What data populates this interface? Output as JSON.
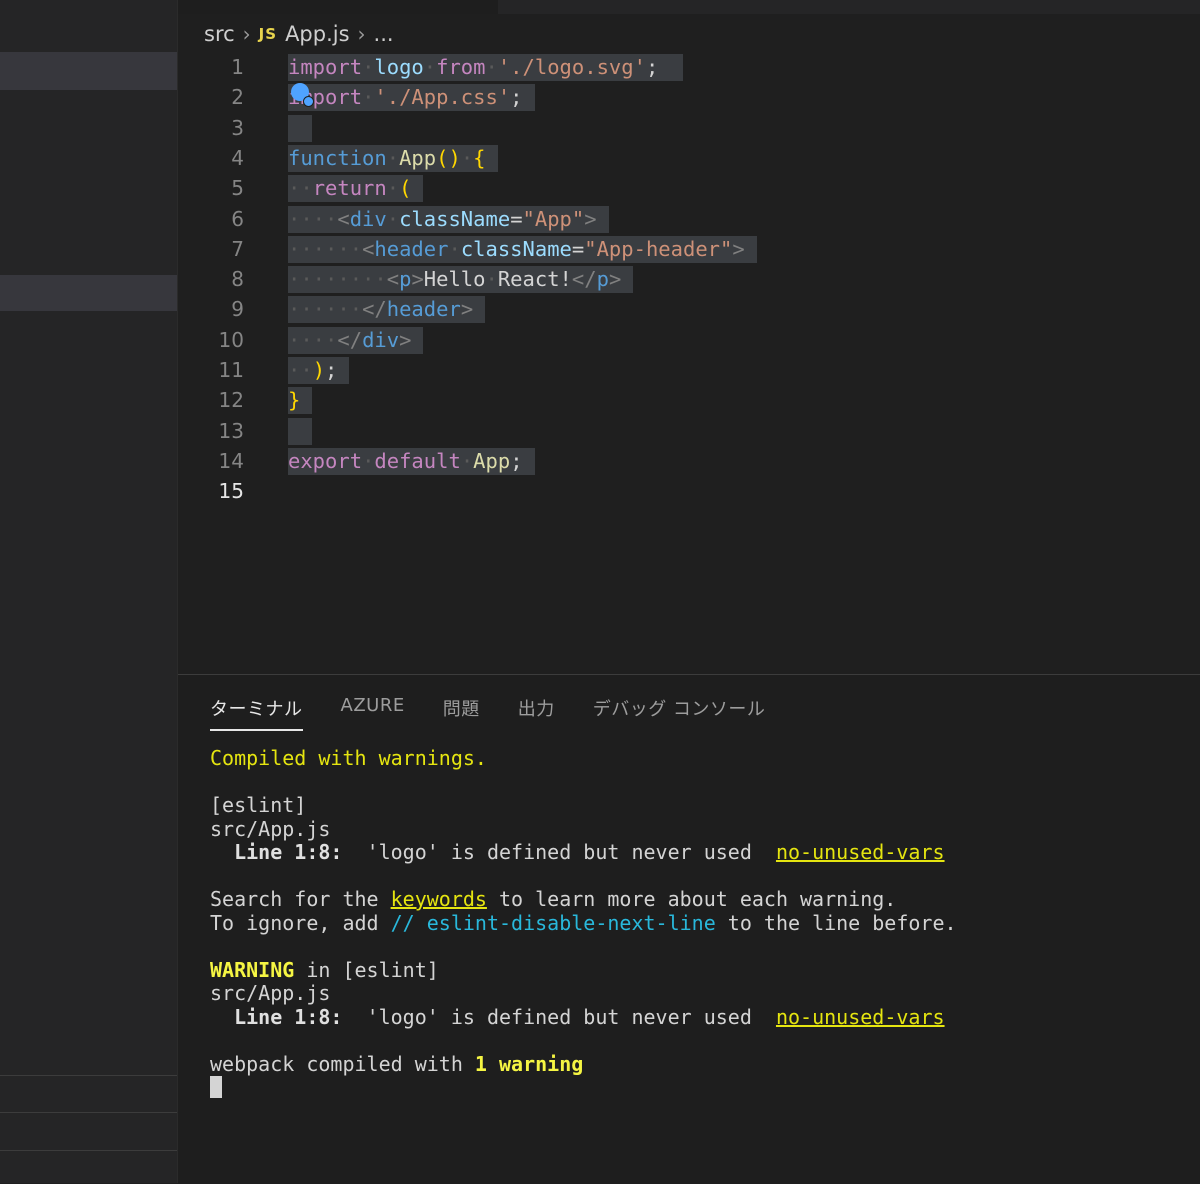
{
  "breadcrumb": {
    "folder": "src",
    "file_badge": "JS",
    "file": "App.js",
    "more": "..."
  },
  "editor": {
    "active_line": 15,
    "lines": [
      {
        "n": "1",
        "tokens": [
          [
            "k1",
            "import"
          ],
          [
            "ws",
            "·"
          ],
          [
            "id",
            "logo"
          ],
          [
            "ws",
            "·"
          ],
          [
            "k1",
            "from"
          ],
          [
            "ws",
            "·"
          ],
          [
            "str",
            "'./logo.svg'"
          ],
          [
            "",
            "; "
          ]
        ]
      },
      {
        "n": "2",
        "tokens": [
          [
            "k1",
            "import"
          ],
          [
            "ws",
            "·"
          ],
          [
            "str",
            "'./App.css'"
          ],
          [
            "",
            ";"
          ]
        ]
      },
      {
        "n": "3",
        "tokens": []
      },
      {
        "n": "4",
        "tokens": [
          [
            "kb",
            "function"
          ],
          [
            "ws",
            "·"
          ],
          [
            "fn",
            "App"
          ],
          [
            "br",
            "()"
          ],
          [
            "ws",
            "·"
          ],
          [
            "br",
            "{"
          ]
        ]
      },
      {
        "n": "5",
        "tokens": [
          [
            "ws",
            "··"
          ],
          [
            "k1",
            "return"
          ],
          [
            "ws",
            "·"
          ],
          [
            "br",
            "("
          ]
        ]
      },
      {
        "n": "6",
        "tokens": [
          [
            "ws",
            "····"
          ],
          [
            "tagp",
            "<"
          ],
          [
            "tag",
            "div"
          ],
          [
            "ws",
            "·"
          ],
          [
            "at",
            "className"
          ],
          [
            "",
            "="
          ],
          [
            "str",
            "\"App\""
          ],
          [
            "tagp",
            ">"
          ]
        ]
      },
      {
        "n": "7",
        "tokens": [
          [
            "ws",
            "······"
          ],
          [
            "tagp",
            "<"
          ],
          [
            "tag",
            "header"
          ],
          [
            "ws",
            "·"
          ],
          [
            "at",
            "className"
          ],
          [
            "",
            "="
          ],
          [
            "str",
            "\"App-header\""
          ],
          [
            "tagp",
            ">"
          ]
        ]
      },
      {
        "n": "8",
        "tokens": [
          [
            "ws",
            "········"
          ],
          [
            "tagp",
            "<"
          ],
          [
            "tag",
            "p"
          ],
          [
            "tagp",
            ">"
          ],
          [
            "",
            "Hello"
          ],
          [
            "ws",
            "·"
          ],
          [
            "",
            "React!"
          ],
          [
            "tagp",
            "</"
          ],
          [
            "tag",
            "p"
          ],
          [
            "tagp",
            ">"
          ]
        ]
      },
      {
        "n": "9",
        "tokens": [
          [
            "ws",
            "······"
          ],
          [
            "tagp",
            "</"
          ],
          [
            "tag",
            "header"
          ],
          [
            "tagp",
            ">"
          ]
        ]
      },
      {
        "n": "10",
        "tokens": [
          [
            "ws",
            "····"
          ],
          [
            "tagp",
            "</"
          ],
          [
            "tag",
            "div"
          ],
          [
            "tagp",
            ">"
          ]
        ]
      },
      {
        "n": "11",
        "tokens": [
          [
            "ws",
            "··"
          ],
          [
            "br",
            ")"
          ],
          [
            "",
            ";"
          ]
        ]
      },
      {
        "n": "12",
        "tokens": [
          [
            "br",
            "}"
          ]
        ]
      },
      {
        "n": "13",
        "tokens": []
      },
      {
        "n": "14",
        "tokens": [
          [
            "k1",
            "export"
          ],
          [
            "ws",
            "·"
          ],
          [
            "k1",
            "default"
          ],
          [
            "ws",
            "·"
          ],
          [
            "fn",
            "App"
          ],
          [
            "",
            ";"
          ]
        ]
      },
      {
        "n": "15",
        "tokens": null
      }
    ]
  },
  "panel": {
    "tabs": [
      "ターミナル",
      "AZURE",
      "問題",
      "出力",
      "デバッグ コンソール"
    ],
    "active_tab": 0
  },
  "terminal": {
    "compiled": "Compiled with warnings.",
    "eslint_tag": "[eslint]",
    "file": "src/App.js",
    "line_label": "Line 1:8:",
    "message": "'logo' is defined but never used",
    "rule": "no-unused-vars",
    "search_pre": "Search for the ",
    "search_kw": "keywords",
    "search_post": " to learn more about each warning.",
    "ignore_pre": "To ignore, add ",
    "ignore_code": "// eslint-disable-next-line",
    "ignore_post": " to the line before.",
    "warning_word": "WARNING",
    "warning_rest": " in [eslint]",
    "webpack_pre": "webpack compiled with ",
    "webpack_count": "1",
    "webpack_post": " warning"
  },
  "colors": {
    "background": "#1f1f1f",
    "selection": "#3a3d41",
    "terminal_yellow": "#e5e510",
    "terminal_cyan": "#29b8db"
  }
}
